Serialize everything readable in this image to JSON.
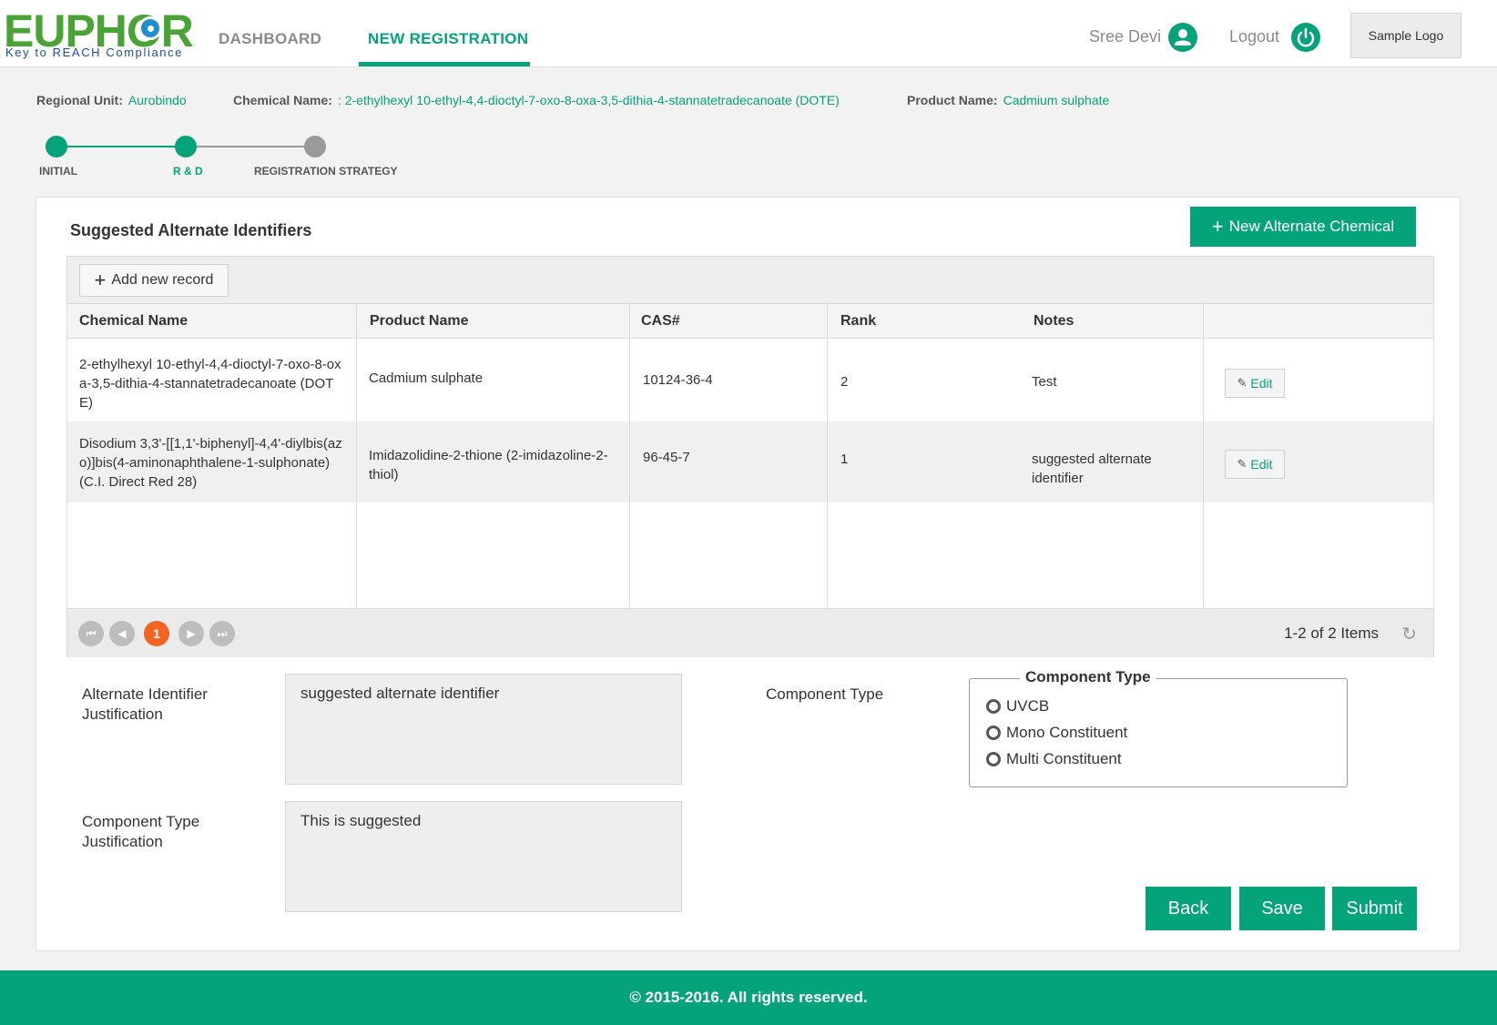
{
  "header": {
    "logo_name": "EUPHOR",
    "logo_tagline": "Key to REACH Compliance",
    "nav": [
      {
        "label": "DASHBOARD"
      },
      {
        "label": "NEW REGISTRATION"
      }
    ],
    "active_nav": "NEW REGISTRATION",
    "user_name": "Sree Devi",
    "user_icon": "user-icon",
    "logout_label": "Logout",
    "logout_icon": "power-icon",
    "sample_logo": "Sample  Logo"
  },
  "info": {
    "regional_unit_label": "Regional Unit:",
    "regional_unit_value": "Aurobindo",
    "chemical_name_label": "Chemical Name:",
    "chemical_name_value": ": 2-ethylhexyl 10-ethyl-4,4-dioctyl-7-oxo-8-oxa-3,5-dithia-4-stannatetradecanoate (DOTE)",
    "product_name_label": "Product Name:",
    "product_name_value": "Cadmium sulphate"
  },
  "stepper": {
    "steps": [
      {
        "label": "INITIAL",
        "state": "done"
      },
      {
        "label": "R & D",
        "state": "current"
      },
      {
        "label": "REGISTRATION STRATEGY",
        "state": "pending"
      }
    ]
  },
  "panel": {
    "title": "Suggested Alternate Identifiers",
    "new_alt_button": "New Alternate Chemical",
    "add_record_button": "Add new record"
  },
  "table": {
    "columns": [
      "Chemical Name",
      "Product Name",
      "CAS#",
      "Rank",
      "Notes"
    ],
    "rows": [
      {
        "chemical_name": "2-ethylhexyl 10-ethyl-4,4-dioctyl-7-oxo-8-oxa-3,5-dithia-4-stannatetradecanoate (DOTE)",
        "product_name": "Cadmium sulphate",
        "cas": "10124-36-4",
        "rank": "2",
        "notes": "Test",
        "edit_label": "Edit"
      },
      {
        "chemical_name": "Disodium 3,3'-[[1,1'-biphenyl]-4,4'-diylbis(azo)]bis(4-aminonaphthalene-1-sulphonate) (C.I. Direct Red 28)",
        "product_name": "Imidazolidine-2-thione (2-imidazoline-2-thiol)",
        "cas": "96-45-7",
        "rank": "1",
        "notes": "suggested alternate identifier",
        "edit_label": "Edit"
      }
    ],
    "pager": {
      "current_page": "1",
      "info": "1-2 of 2 Items"
    }
  },
  "form": {
    "alt_justification_label": "Alternate Identifier Justification",
    "alt_justification_value": "suggested alternate identifier",
    "component_type_label": "Component Type",
    "component_justification_label": "Component Type Justification",
    "component_justification_value": "This is suggested",
    "component_type_legend": "Component Type",
    "component_type_options": [
      "UVCB",
      "Mono Constituent",
      "Multi Constituent"
    ]
  },
  "actions": {
    "back": "Back",
    "save": "Save",
    "submit": "Submit"
  },
  "footer": {
    "text": "© 2015-2016. All rights reserved."
  },
  "colors": {
    "accent": "#04a37a",
    "pager_active": "#f26522",
    "logo_green": "#4aa435",
    "logo_blue": "#1c4e9c"
  }
}
